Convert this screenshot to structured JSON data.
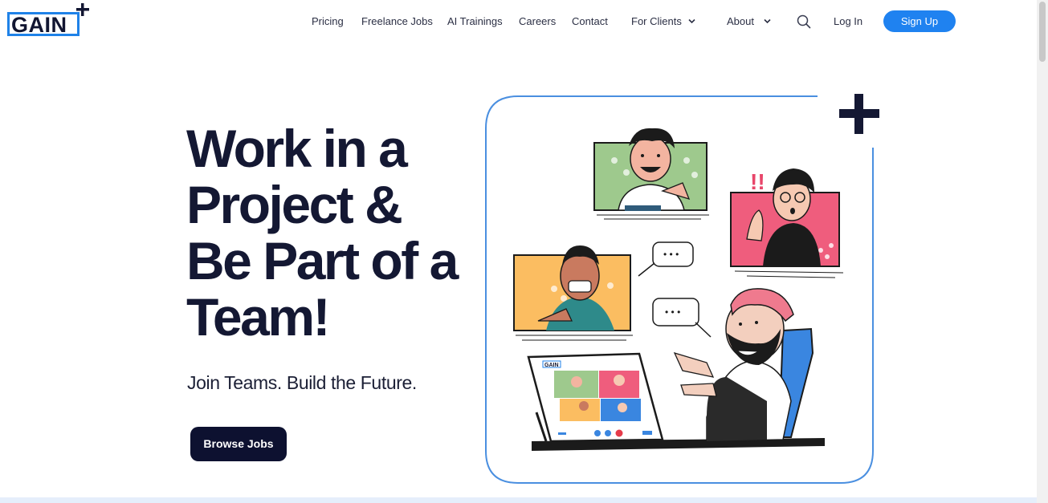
{
  "brand": {
    "logo_text": "GAIN",
    "accent": "#1f82e8",
    "dark": "#141833"
  },
  "nav": {
    "items": [
      {
        "label": "Pricing"
      },
      {
        "label": "Freelance Jobs"
      },
      {
        "label": "AI Trainings"
      },
      {
        "label": "Careers"
      },
      {
        "label": "Contact"
      },
      {
        "label": "For Clients",
        "icon": "chevron-down-icon"
      },
      {
        "label": "About",
        "icon": "chevron-down-icon"
      }
    ],
    "search_icon": "search-icon",
    "login_label": "Log In",
    "signup_label": "Sign Up"
  },
  "hero": {
    "title_lines": [
      "Work in a",
      "Project &",
      "Be Part of a",
      "Team!"
    ],
    "subtitle": "Join Teams. Build the Future.",
    "cta_label": "Browse Jobs"
  },
  "illustration": {
    "screen_logo": "GAIN",
    "bubble_text": "• • •"
  }
}
